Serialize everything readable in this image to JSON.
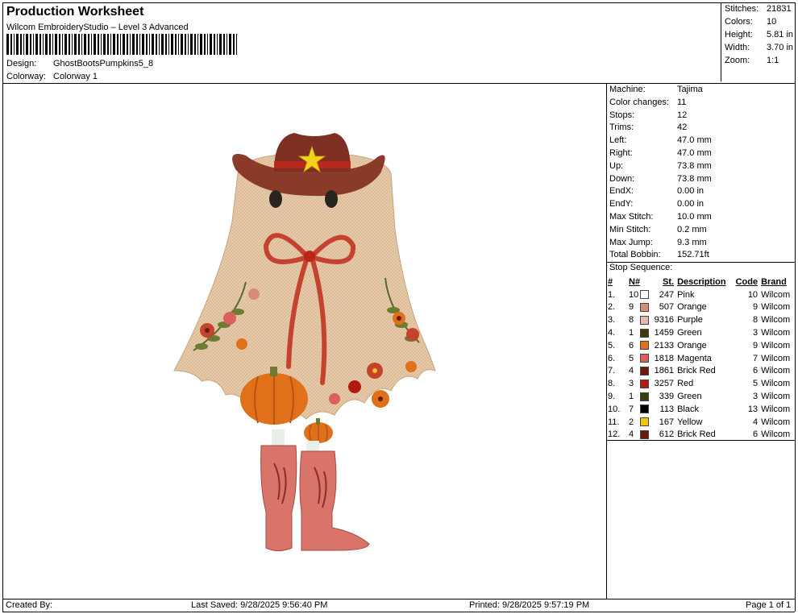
{
  "header": {
    "title": "Production Worksheet",
    "subtitle": "Wilcom EmbroideryStudio – Level 3 Advanced",
    "design_label": "Design:",
    "design_value": "GhostBootsPumpkins5_8",
    "colorway_label": "Colorway:",
    "colorway_value": "Colorway 1"
  },
  "stats": [
    {
      "k": "Stitches:",
      "v": "21831"
    },
    {
      "k": "Colors:",
      "v": "10"
    },
    {
      "k": "Height:",
      "v": "5.81 in"
    },
    {
      "k": "Width:",
      "v": "3.70 in"
    },
    {
      "k": "Zoom:",
      "v": "1:1"
    }
  ],
  "info": [
    {
      "k": "Machine:",
      "v": "Tajima"
    },
    {
      "k": "Color changes:",
      "v": "11"
    },
    {
      "k": "Stops:",
      "v": "12"
    },
    {
      "k": "Trims:",
      "v": "42"
    },
    {
      "k": "Left:",
      "v": "47.0 mm"
    },
    {
      "k": "Right:",
      "v": "47.0 mm"
    },
    {
      "k": "Up:",
      "v": "73.8 mm"
    },
    {
      "k": "Down:",
      "v": "73.8 mm"
    },
    {
      "k": "EndX:",
      "v": "0.00 in"
    },
    {
      "k": "EndY:",
      "v": "0.00 in"
    },
    {
      "k": "Max Stitch:",
      "v": "10.0 mm"
    },
    {
      "k": "Min Stitch:",
      "v": "0.2 mm"
    },
    {
      "k": "Max Jump:",
      "v": "9.3 mm"
    },
    {
      "k": "Total Bobbin:",
      "v": "152.71ft"
    }
  ],
  "stop_sequence": {
    "title": "Stop Sequence:",
    "headers": [
      "#",
      "N#",
      "St.",
      "Description",
      "Code",
      "Brand"
    ],
    "rows": [
      {
        "i": "1.",
        "n": "10",
        "color": "#ffffff",
        "st": "247",
        "desc": "Pink",
        "code": "10",
        "brand": "Wilcom"
      },
      {
        "i": "2.",
        "n": "9",
        "color": "#d98c75",
        "st": "507",
        "desc": "Orange",
        "code": "9",
        "brand": "Wilcom"
      },
      {
        "i": "3.",
        "n": "8",
        "color": "#e8b8a8",
        "st": "9316",
        "desc": "Purple",
        "code": "8",
        "brand": "Wilcom"
      },
      {
        "i": "4.",
        "n": "1",
        "color": "#3d3d0d",
        "st": "1459",
        "desc": "Green",
        "code": "3",
        "brand": "Wilcom"
      },
      {
        "i": "5.",
        "n": "6",
        "color": "#e0701a",
        "st": "2133",
        "desc": "Orange",
        "code": "9",
        "brand": "Wilcom"
      },
      {
        "i": "6.",
        "n": "5",
        "color": "#d9615a",
        "st": "1818",
        "desc": "Magenta",
        "code": "7",
        "brand": "Wilcom"
      },
      {
        "i": "7.",
        "n": "4",
        "color": "#6b1a0d",
        "st": "1861",
        "desc": "Brick Red",
        "code": "6",
        "brand": "Wilcom"
      },
      {
        "i": "8.",
        "n": "3",
        "color": "#b01c10",
        "st": "3257",
        "desc": "Red",
        "code": "5",
        "brand": "Wilcom"
      },
      {
        "i": "9.",
        "n": "1",
        "color": "#3d3d0d",
        "st": "339",
        "desc": "Green",
        "code": "3",
        "brand": "Wilcom"
      },
      {
        "i": "10.",
        "n": "7",
        "color": "#000000",
        "st": "113",
        "desc": "Black",
        "code": "13",
        "brand": "Wilcom"
      },
      {
        "i": "11.",
        "n": "2",
        "color": "#f2c30f",
        "st": "167",
        "desc": "Yellow",
        "code": "4",
        "brand": "Wilcom"
      },
      {
        "i": "12.",
        "n": "4",
        "color": "#6b1a0d",
        "st": "612",
        "desc": "Brick Red",
        "code": "6",
        "brand": "Wilcom"
      }
    ]
  },
  "footer": {
    "created": "Created By:",
    "saved": "Last Saved: 9/28/2025 9:56:40 PM",
    "printed": "Printed: 9/28/2025 9:57:19 PM",
    "page": "Page 1 of 1"
  }
}
